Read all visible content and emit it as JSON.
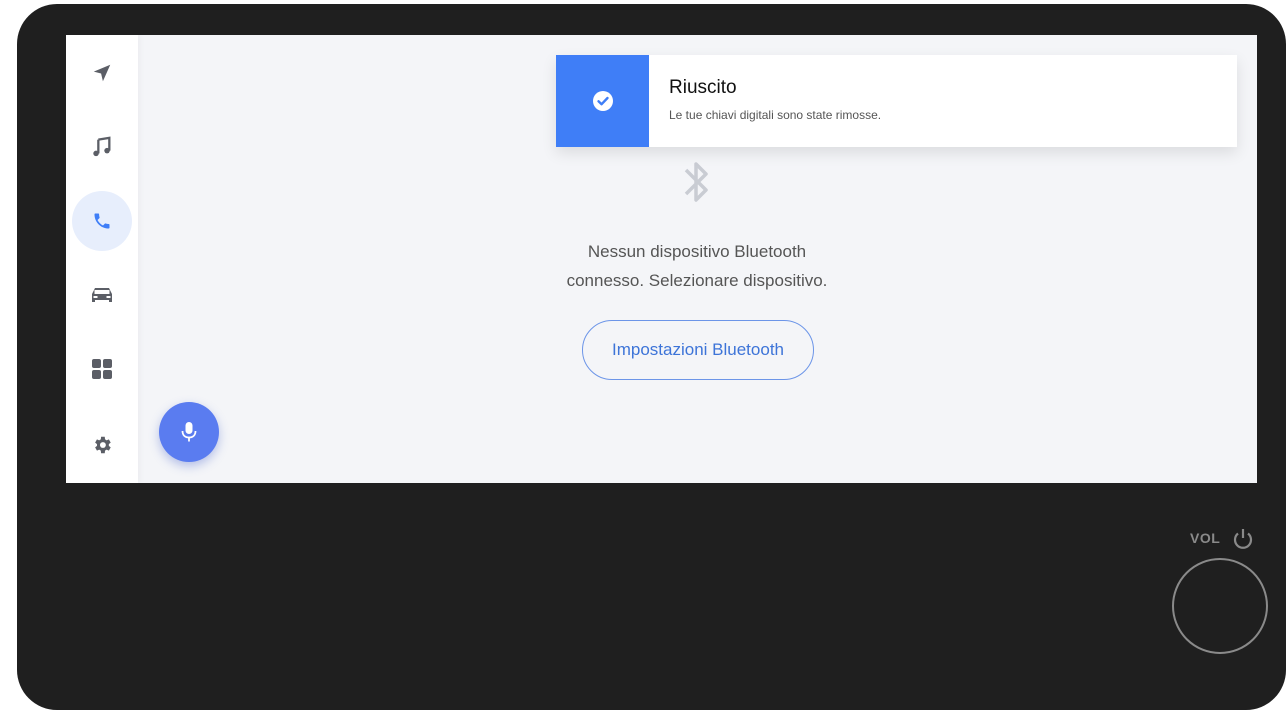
{
  "sidebar": {
    "items": [
      {
        "icon": "navigation-icon",
        "active": false
      },
      {
        "icon": "music-note-icon",
        "active": false
      },
      {
        "icon": "phone-icon",
        "active": true
      },
      {
        "icon": "car-icon",
        "active": false
      },
      {
        "icon": "apps-grid-icon",
        "active": false
      },
      {
        "icon": "gear-icon",
        "active": false
      }
    ]
  },
  "voice": {
    "icon": "microphone-icon"
  },
  "toast": {
    "title": "Riuscito",
    "message": "Le tue chiavi digitali sono state rimosse.",
    "icon": "check-circle-icon",
    "accent": "#3f7ef7"
  },
  "bluetooth": {
    "icon": "bluetooth-icon",
    "message_line1": "Nessun dispositivo Bluetooth",
    "message_line2": "connesso. Selezionare dispositivo.",
    "button_label": "Impostazioni Bluetooth"
  },
  "hardware": {
    "volume_label": "VOL",
    "power_icon": "power-icon",
    "knob": "volume-knob"
  },
  "colors": {
    "bezel": "#1f1f1f",
    "screen_bg": "#f4f5f8",
    "active_nav_bg": "#e7eefc",
    "mic_button": "#5a7cf0",
    "button_border": "#6c95e8"
  }
}
